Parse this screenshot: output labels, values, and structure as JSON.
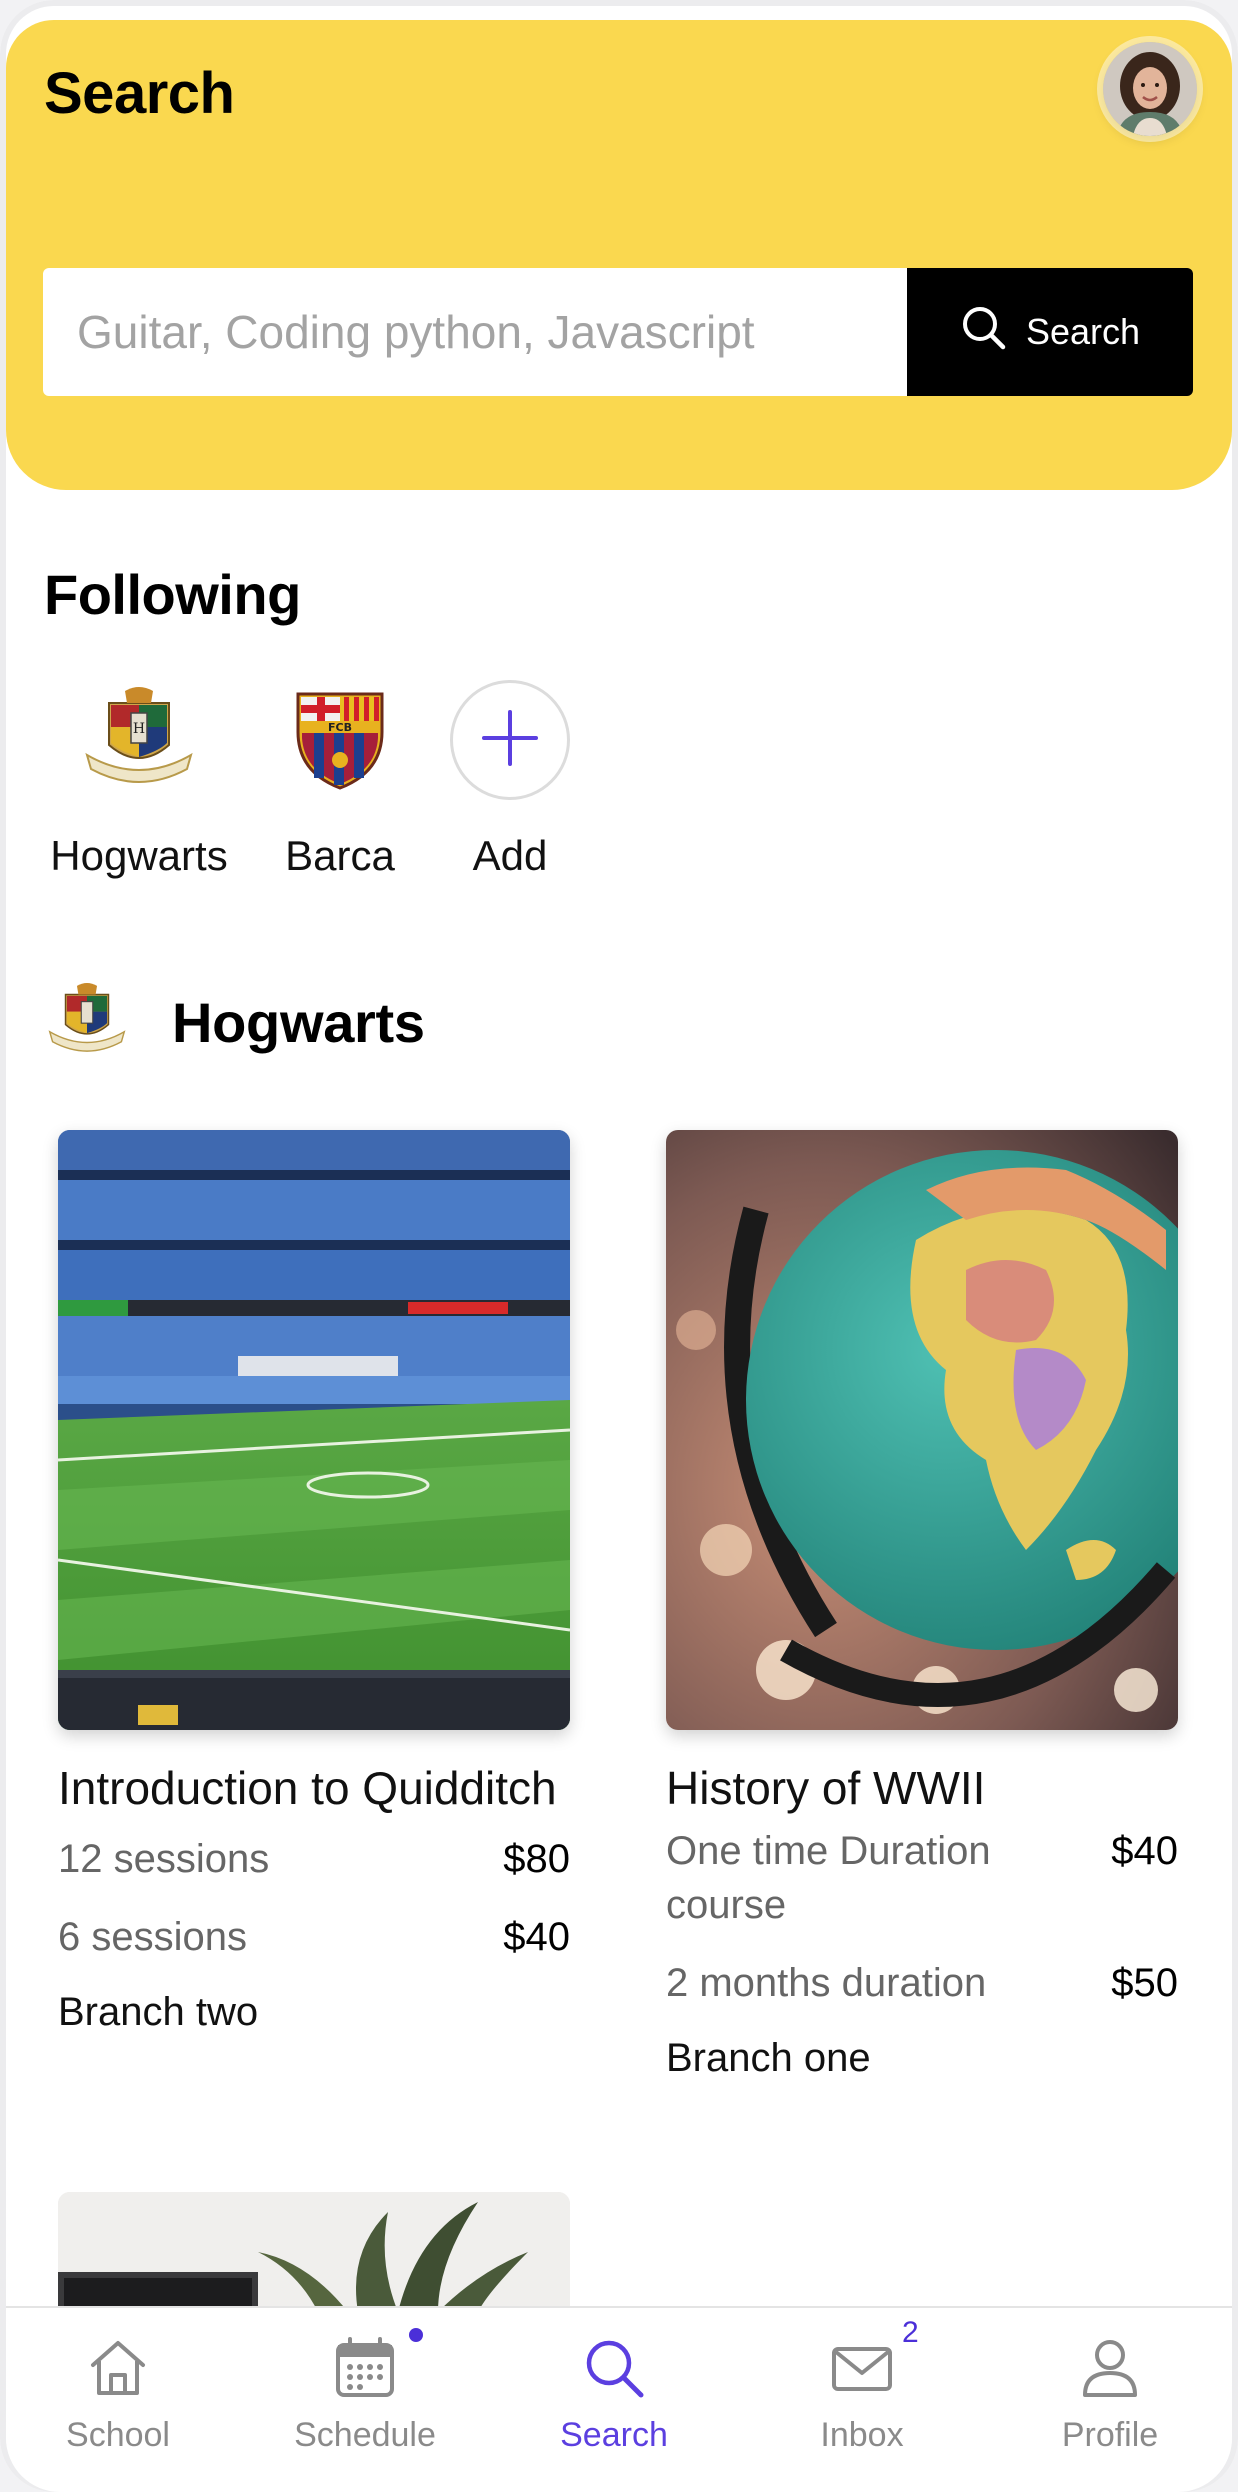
{
  "header": {
    "title": "Search",
    "avatar_icon": "user-avatar-photo"
  },
  "search": {
    "placeholder": "Guitar, Coding python, Javascript",
    "button_label": "Search"
  },
  "following": {
    "title": "Following",
    "items": [
      {
        "label": "Hogwarts",
        "icon": "hogwarts-crest-icon"
      },
      {
        "label": "Barca",
        "icon": "barca-crest-icon"
      },
      {
        "label": "Add",
        "icon": "plus-icon"
      }
    ]
  },
  "school": {
    "name": "Hogwarts",
    "courses": [
      {
        "title": "Introduction to Quidditch",
        "image": "stadium-photo",
        "prices": [
          {
            "label": "12 sessions",
            "price": "$80"
          },
          {
            "label": "6 sessions",
            "price": "$40"
          }
        ],
        "branch": "Branch two"
      },
      {
        "title": "History of WWII",
        "image": "globe-photo",
        "prices": [
          {
            "label": "One time Duration course",
            "price": "$40"
          },
          {
            "label": "2 months duration",
            "price": "$50"
          }
        ],
        "branch": "Branch one"
      }
    ]
  },
  "tabbar": {
    "tabs": [
      {
        "label": "School",
        "icon": "home-icon",
        "active": false
      },
      {
        "label": "Schedule",
        "icon": "calendar-icon",
        "active": false,
        "dot": true
      },
      {
        "label": "Search",
        "icon": "search-icon",
        "active": true
      },
      {
        "label": "Inbox",
        "icon": "mail-icon",
        "active": false,
        "badge": "2"
      },
      {
        "label": "Profile",
        "icon": "person-icon",
        "active": false
      }
    ]
  },
  "colors": {
    "header_bg": "#fad84f",
    "accent": "#5b3fe0",
    "search_button": "#000000"
  }
}
